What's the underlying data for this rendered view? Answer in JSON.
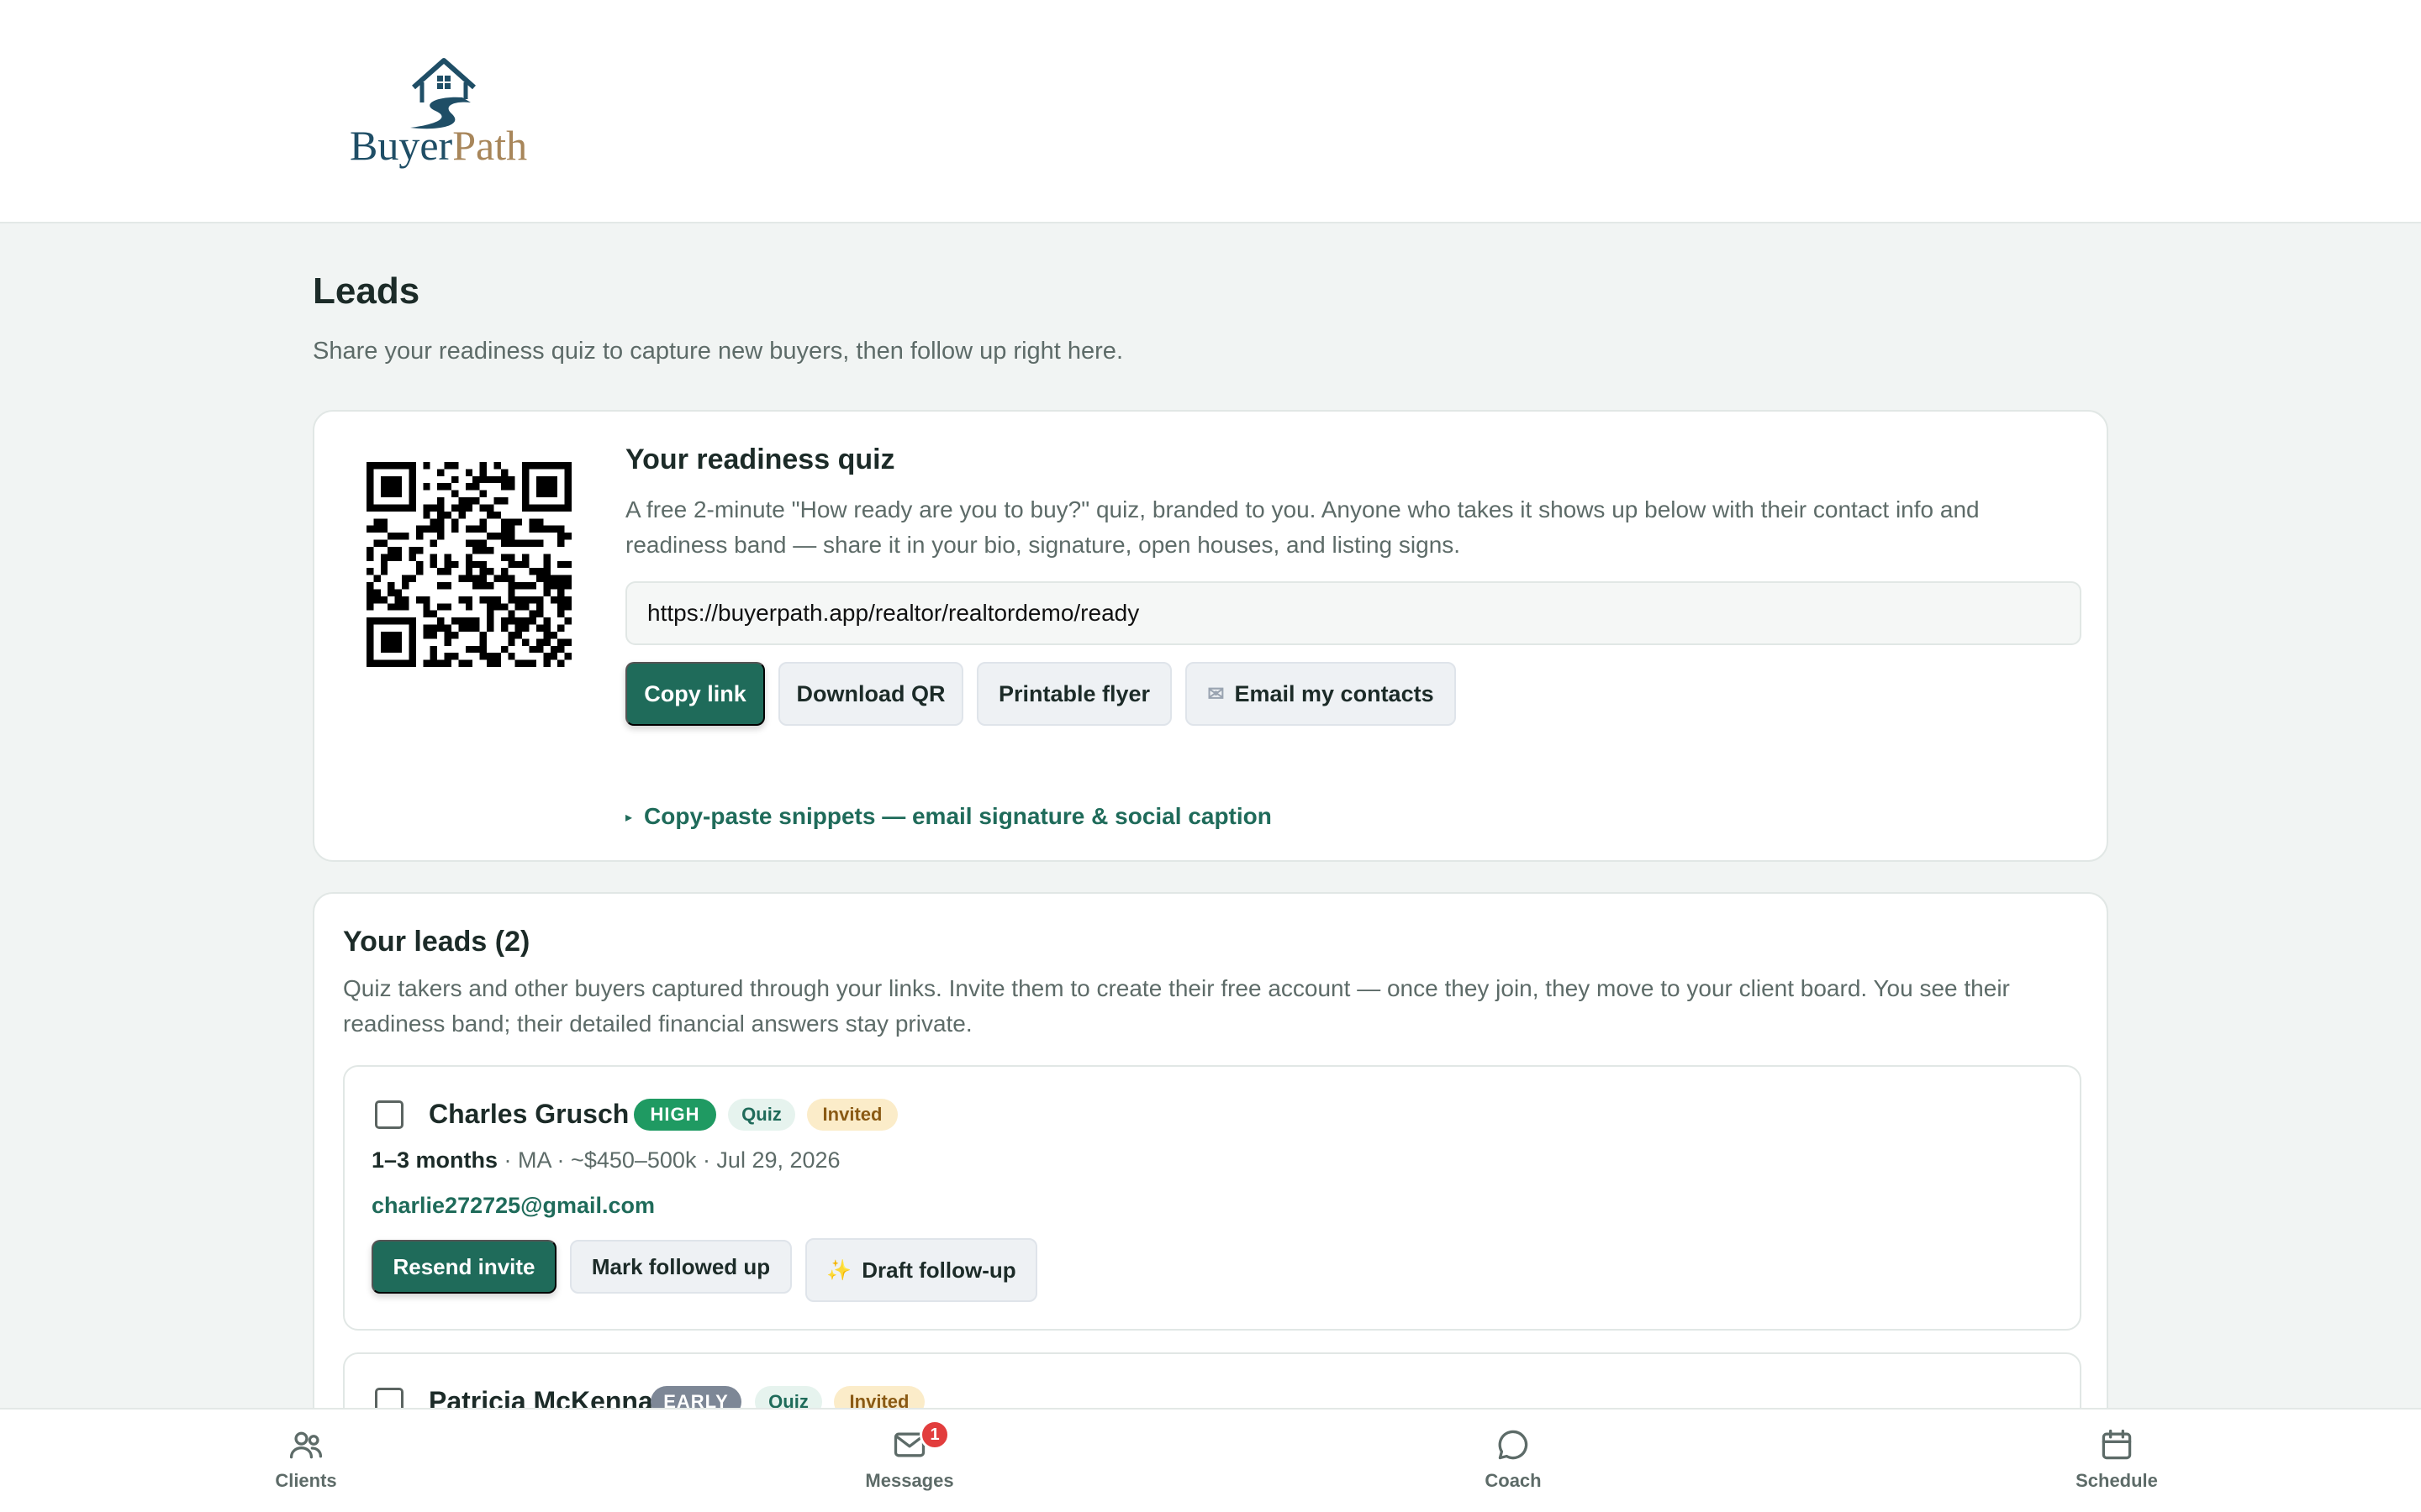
{
  "brand": {
    "logo_part1": "Buyer",
    "logo_part2": "Path",
    "color_primary": "#1f6b5a",
    "color_logo_blue": "#1f4e66",
    "color_logo_gold": "#a8865a"
  },
  "page": {
    "title": "Leads",
    "subtitle": "Share your readiness quiz to capture new buyers, then follow up right here."
  },
  "quiz": {
    "qr_icon": "qr-code",
    "title": "Your readiness quiz",
    "description": "A free 2-minute \"How ready are you to buy?\" quiz, branded to you. Anyone who takes it shows up below with their contact info and readiness band — share it in your bio, signature, open houses, and listing signs.",
    "url": "https://buyerpath.app/realtor/realtordemo/ready",
    "buttons": {
      "copy_link": "Copy link",
      "download_qr": "Download QR",
      "printable_flyer": "Printable flyer",
      "email_contacts": "Email my contacts"
    },
    "snippets_label": "Copy-paste snippets — email signature & social caption"
  },
  "leads": {
    "title": "Your leads (2)",
    "description": "Quiz takers and other buyers captured through your links. Invite them to create their free account — once they join, they move to your client board. You see their readiness band; their detailed financial answers stay private.",
    "items": [
      {
        "name": "Charles Grusch",
        "band": "HIGH",
        "source": "Quiz",
        "status": "Invited",
        "timeline": "1–3 months",
        "meta_rest": " · MA · ~$450–500k · Jul 29, 2026",
        "email": "charlie272725@gmail.com",
        "buttons": {
          "resend": "Resend invite",
          "mark_followed": "Mark followed up",
          "draft_followup": "Draft follow-up"
        }
      },
      {
        "name": "Patricia McKenna",
        "band": "EARLY",
        "source": "Quiz",
        "status": "Invited"
      }
    ]
  },
  "nav": {
    "items": [
      {
        "label": "Clients",
        "icon": "users-icon"
      },
      {
        "label": "Messages",
        "icon": "mail-icon",
        "badge": "1"
      },
      {
        "label": "Coach",
        "icon": "chat-icon"
      },
      {
        "label": "Schedule",
        "icon": "calendar-icon"
      }
    ]
  }
}
